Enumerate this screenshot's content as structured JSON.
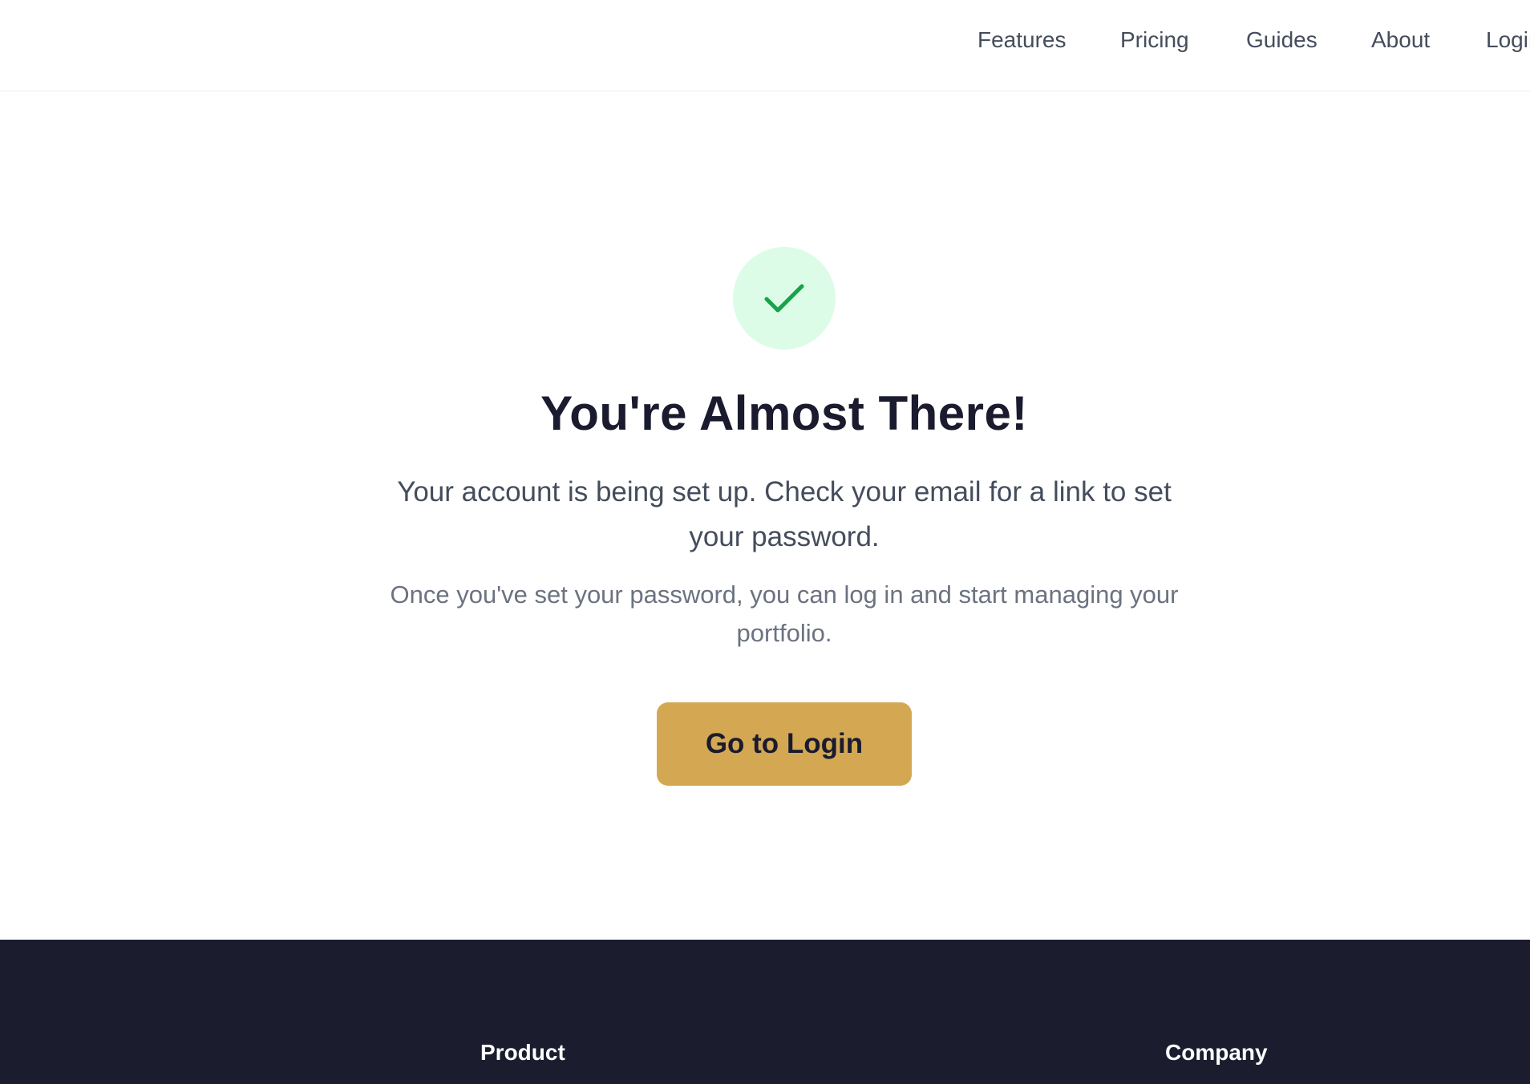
{
  "nav": {
    "links": [
      {
        "label": "Features"
      },
      {
        "label": "Pricing"
      },
      {
        "label": "Guides"
      },
      {
        "label": "About"
      },
      {
        "label": "Login"
      }
    ]
  },
  "hero": {
    "icon": "checkmark-icon",
    "title": "You're Almost There!",
    "lead": "Your account is being set up. Check your email for a link to set your password.",
    "subtext": "Once you've set your password, you can log in and start managing your portfolio.",
    "button_label": "Go to Login"
  },
  "footer": {
    "columns": [
      {
        "heading": "Product"
      },
      {
        "heading": "Company"
      }
    ]
  },
  "colors": {
    "accent": "#d4a853",
    "success_bg": "#dcfce7",
    "success_icon": "#16a34a",
    "footer_bg": "#1b1c2e",
    "heading_text": "#1a1b2e"
  }
}
